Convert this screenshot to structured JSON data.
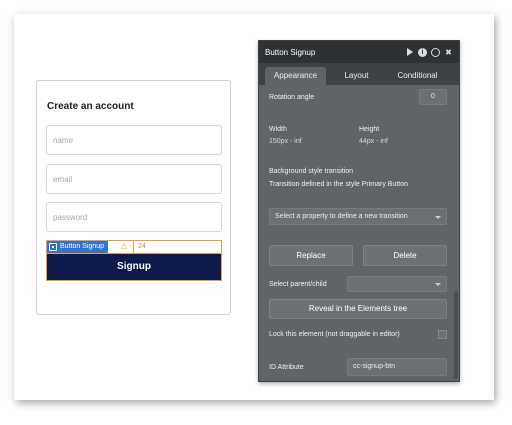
{
  "card": {
    "title": "Create an account",
    "fields": {
      "name_placeholder": "name",
      "email_placeholder": "email",
      "password_placeholder": "password"
    },
    "selection": {
      "tag_label": "Button Signup",
      "value": "24"
    },
    "signup_label": "Signup"
  },
  "panel": {
    "title": "Button Signup",
    "icons": [
      "play-icon",
      "info-icon",
      "comment-icon",
      "close-icon"
    ],
    "tabs": [
      "Appearance",
      "Layout",
      "Conditional"
    ],
    "rotation_label": "Rotation angle",
    "rotation_value": "0",
    "width_label": "Width",
    "width_value": "150px - inf",
    "height_label": "Height",
    "height_value": "44px - inf",
    "bg_transition_label": "Background style transition",
    "transition_note": "Transition defined in the style Primary Button",
    "transition_select": "Select a property to define a new transition",
    "replace_label": "Replace",
    "delete_label": "Delete",
    "parent_child_label": "Select parent/child",
    "reveal_label": "Reveal in the Elements tree",
    "lock_label": "Lock this element (not draggable in editor)",
    "id_label": "ID Attribute",
    "id_value": "cc-signup-btn"
  },
  "colors": {
    "signup_bg": "#0d1a4a",
    "selection_tag": "#2f74d4",
    "selection_border": "#f29b45",
    "panel_bg": "#5f6466",
    "panel_header": "#2e3235"
  }
}
